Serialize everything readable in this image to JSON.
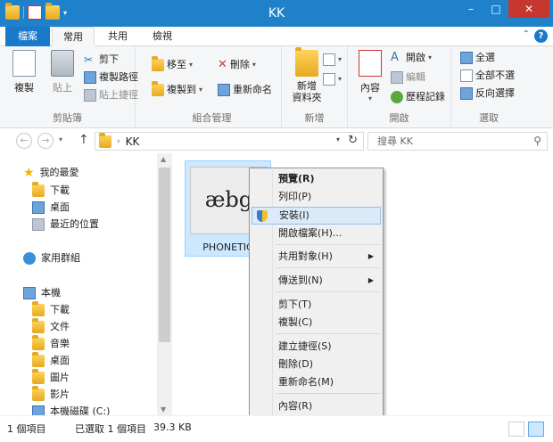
{
  "window": {
    "title": "KK",
    "minimize": "–",
    "maximize": "□",
    "close": "✕"
  },
  "tabs": {
    "file": "檔案",
    "home": "常用",
    "share": "共用",
    "view": "檢視",
    "help": "?",
    "collapse": "⌃"
  },
  "ribbon": {
    "clipboard": {
      "label": "剪貼簿",
      "copy": "複製",
      "paste": "貼上",
      "cut": "剪下",
      "copy_path": "複製路徑",
      "paste_shortcut": "貼上捷徑"
    },
    "organize": {
      "label": "組合管理",
      "move_to": "移至",
      "copy_to": "複製到",
      "delete": "刪除",
      "rename": "重新命名"
    },
    "new": {
      "label": "新增",
      "new_folder": "新增\n資料夾"
    },
    "open": {
      "label": "開啟",
      "properties": "內容",
      "open": "開啟",
      "edit": "編輯",
      "history": "歷程記錄"
    },
    "select": {
      "label": "選取",
      "select_all": "全選",
      "select_none": "全部不選",
      "invert": "反向選擇"
    }
  },
  "address": {
    "path": "KK",
    "search_placeholder": "搜尋 KK"
  },
  "navpane": {
    "favorites": "我的最愛",
    "downloads": "下載",
    "desktop": "桌面",
    "recent": "最近的位置",
    "homegroup": "家用群組",
    "this_pc": "本機",
    "pc_downloads": "下載",
    "documents": "文件",
    "music": "音樂",
    "pc_desktop": "桌面",
    "pictures": "圖片",
    "videos": "影片",
    "local_disk": "本機磁碟 (C:)"
  },
  "file": {
    "name": "PHONETIC",
    "preview_text": "æbg"
  },
  "context_menu": {
    "preview": "預覽(R)",
    "print": "列印(P)",
    "install": "安裝(I)",
    "open_location": "開啟檔案(H)...",
    "share_with": "共用對象(H)",
    "send_to": "傳送到(N)",
    "cut": "剪下(T)",
    "copy": "複製(C)",
    "create_shortcut": "建立捷徑(S)",
    "delete": "刪除(D)",
    "rename": "重新命名(M)",
    "properties": "內容(R)"
  },
  "status": {
    "count": "1 個項目",
    "selected": "已選取 1 個項目",
    "size": "39.3 KB"
  }
}
